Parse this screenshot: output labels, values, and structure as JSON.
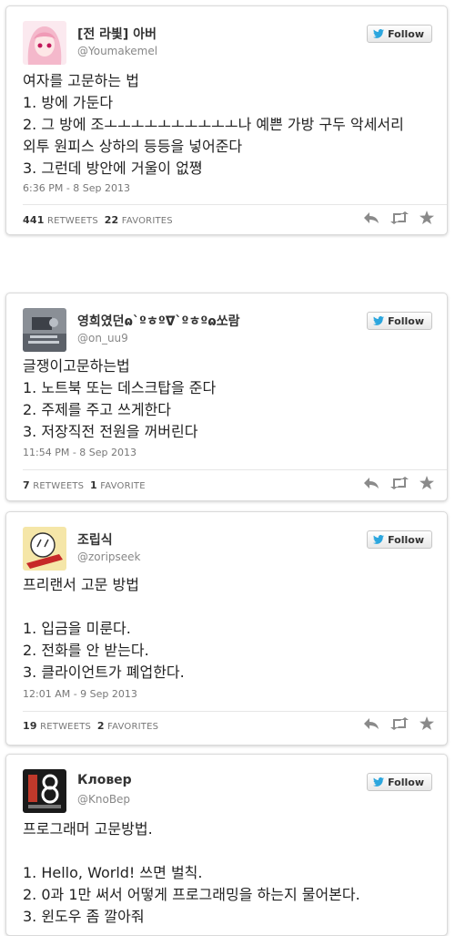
{
  "follow_label": "Follow",
  "tweets": [
    {
      "name": "[전 라븿] 아버",
      "handle": "@Youmakemel",
      "lines": [
        "여자를 고문하는 법",
        "1. 방에 가둔다",
        "2. 그 방에 조ㅗㅗㅗㅗㅗㅗㅗㅗㅗㅗ나 예쁜 가방 구두 악세서리",
        "외투 원피스 상하의 등등을 넣어준다",
        "3. 그런데 방안에 거울이 없쪙"
      ],
      "timestamp": "6:36 PM - 8 Sep 2013",
      "retweets": "441",
      "retweets_label": "RETWEETS",
      "favorites": "22",
      "favorites_label": "FAVORITES"
    },
    {
      "name": "영희였던ɷ`ºㅎºᐁ`ºㅎºɷ쏘람",
      "handle": "@on_uu9",
      "lines": [
        "글쟁이고문하는법",
        "1. 노트북 또는 데스크탑을 준다",
        "2. 주제를 주고 쓰게한다",
        "3. 저장직전 전원을 꺼버린다"
      ],
      "timestamp": "11:54 PM - 8 Sep 2013",
      "retweets": "7",
      "retweets_label": "RETWEETS",
      "favorites": "1",
      "favorites_label": "FAVORITE"
    },
    {
      "name": "조립식",
      "handle": "@zoripseek",
      "lines": [
        "프리랜서 고문 방법",
        "",
        "1. 입금을 미룬다.",
        "2. 전화를 안 받는다.",
        "3. 클라이언트가 폐업한다."
      ],
      "timestamp": "12:01 AM - 9 Sep 2013",
      "retweets": "19",
      "retweets_label": "RETWEETS",
      "favorites": "2",
      "favorites_label": "FAVORITES"
    },
    {
      "name": "Кловер",
      "handle": "@KnoBep",
      "lines": [
        "프로그래머 고문방법.",
        "",
        "1. Hello, World! 쓰면 벌칙.",
        "2. 0과 1만 써서 어떻게 프로그래밍을 하는지 물어본다.",
        "3. 윈도우 좀 깔아줘"
      ]
    }
  ],
  "colors": {
    "twitter_blue": "#2ba6de",
    "avatar4_bg": "#1a1a1a",
    "avatar4_red": "#c0392b"
  },
  "icons": [
    "reply-icon",
    "retweet-icon",
    "favorite-icon",
    "twitter-bird-icon"
  ]
}
